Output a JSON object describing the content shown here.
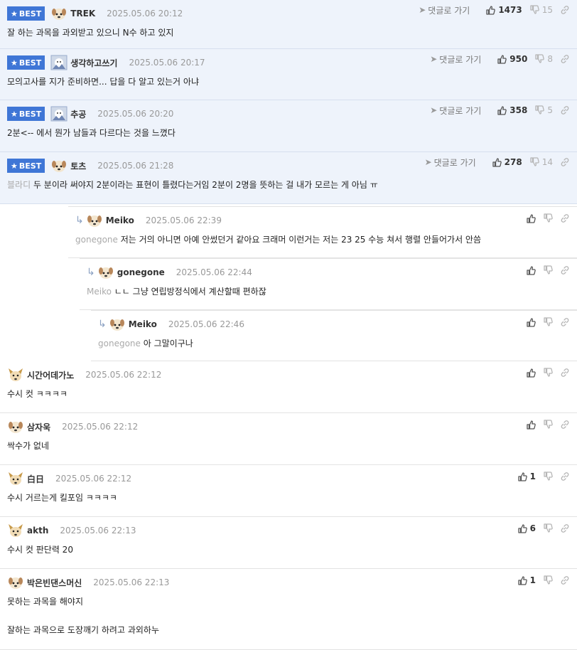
{
  "labels": {
    "best": "BEST",
    "goto": "댓글로 가기"
  },
  "icons": {
    "star": "star-icon",
    "arrow": "reply-arrow-icon",
    "plane": "send-icon",
    "like": "thumbs-up-icon",
    "dislike": "thumbs-down-icon",
    "link": "link-icon"
  },
  "colors": {
    "best_badge": "#3f76d6",
    "best_bg": "#eef3fb",
    "mention": "#aaaaaa"
  },
  "comments": [
    {
      "best": true,
      "nick": "TREK",
      "date": "2025.05.06 20:12",
      "up": "1473",
      "down": "15",
      "mention": "",
      "text": "잘 하는 과목을 과외받고 있으니 N수 하고 있지",
      "avatar": "dog"
    },
    {
      "best": true,
      "nick": "생각하고쓰기",
      "date": "2025.05.06 20:17",
      "up": "950",
      "down": "8",
      "mention": "",
      "text": "모의고사를 지가 준비하면... 답을 다 알고 있는거 아냐",
      "avatar": "photo"
    },
    {
      "best": true,
      "nick": "추공",
      "date": "2025.05.06 20:20",
      "up": "358",
      "down": "5",
      "mention": "",
      "text": "2분<-- 에서 뭔가 남들과 다르다는 것을 느꼈다",
      "avatar": "photo"
    },
    {
      "best": true,
      "nick": "토츠",
      "date": "2025.05.06 21:28",
      "up": "278",
      "down": "14",
      "mention": "블라디",
      "text": "두 분이라 써야지 2분이라는 표현이 틀렸다는거임 2분이 2명을 뜻하는 걸 내가 모르는 게 아님 ㅠ",
      "avatar": "dog"
    },
    {
      "nick": "Meiko",
      "date": "2025.05.06 22:39",
      "up": "",
      "down": "",
      "mention": "gonegone",
      "text": "저는 거의 아니면 아예 안썼던거 같아요 크래머 이런거는 저는 23 25 수능 쳐서 행렬 안들어가서 안씀",
      "avatar": "dog"
    },
    {
      "nick": "gonegone",
      "date": "2025.05.06 22:44",
      "up": "",
      "down": "",
      "mention": "Meiko",
      "text": "ㄴㄴ 그냥 연립방정식에서 계산할때 편하잖",
      "avatar": "dog"
    },
    {
      "nick": "Meiko",
      "date": "2025.05.06 22:46",
      "up": "",
      "down": "",
      "mention": "gonegone",
      "text": "아 그말이구나",
      "avatar": "dog"
    },
    {
      "nick": "시간어데가노",
      "date": "2025.05.06 22:12",
      "up": "",
      "down": "",
      "mention": "",
      "text": "수시 컷 ㅋㅋㅋㅋ",
      "avatar": "fox"
    },
    {
      "nick": "삼자욱",
      "date": "2025.05.06 22:12",
      "up": "",
      "down": "",
      "mention": "",
      "text": "싹수가 없네",
      "avatar": "dog"
    },
    {
      "nick": "白日",
      "date": "2025.05.06 22:12",
      "up": "1",
      "down": "",
      "mention": "",
      "text": "수시 거르는게 킬포임 ㅋㅋㅋㅋ",
      "avatar": "fox"
    },
    {
      "nick": "akth",
      "date": "2025.05.06 22:13",
      "up": "6",
      "down": "",
      "mention": "",
      "text": "수시 컷 판단력 20",
      "avatar": "fox"
    },
    {
      "nick": "박은빈댄스머신",
      "date": "2025.05.06 22:13",
      "up": "1",
      "down": "",
      "mention": "",
      "text": "못하는 과목을 해야지",
      "text2": "잘하는 과목으로 도장깨기 하려고 과외하누",
      "avatar": "dog"
    }
  ]
}
